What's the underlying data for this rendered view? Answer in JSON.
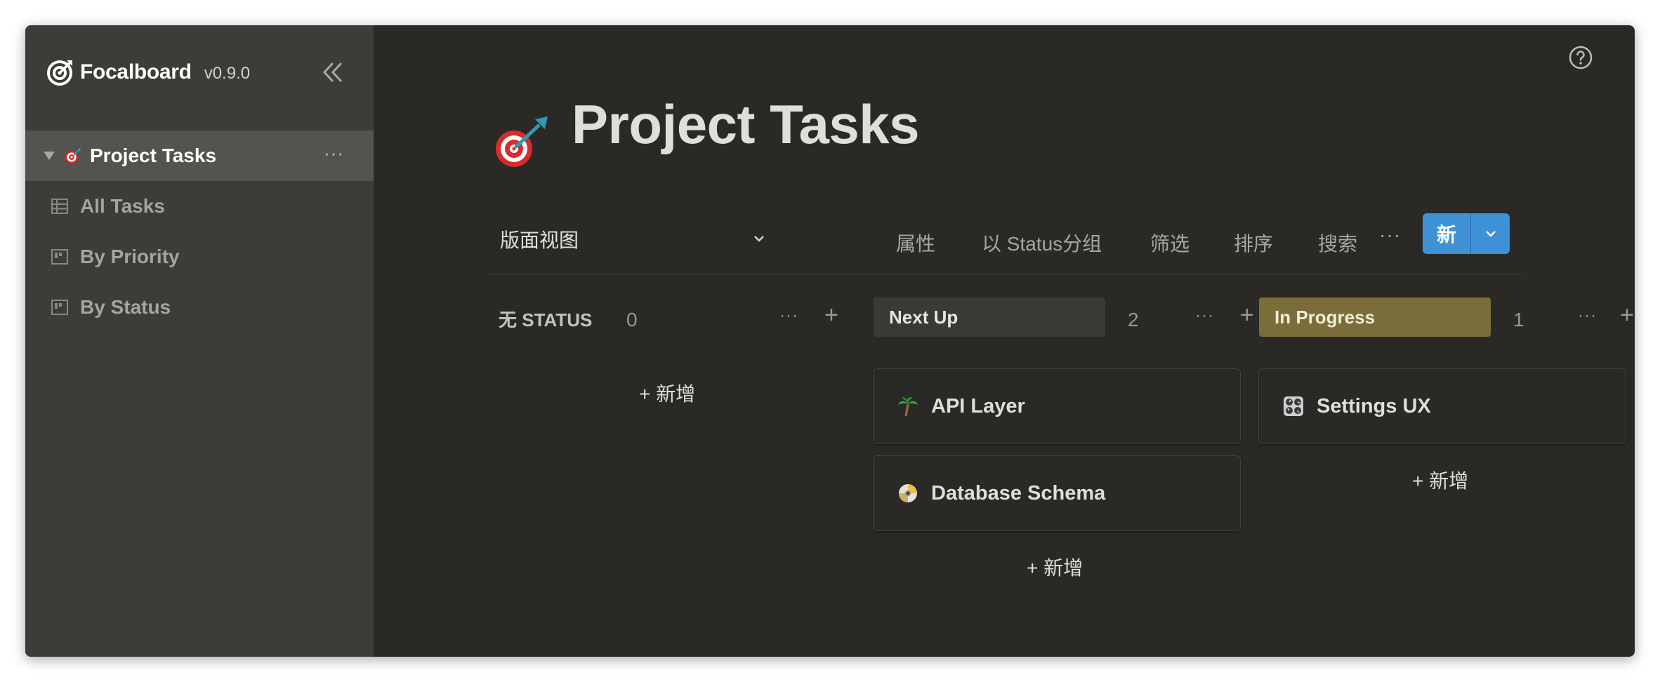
{
  "app": {
    "name": "Focalboard",
    "version": "v0.9.0"
  },
  "sidebar": {
    "board": {
      "label": "Project Tasks",
      "more": "···"
    },
    "views": [
      {
        "label": "All Tasks",
        "icon": "table-icon"
      },
      {
        "label": "By Priority",
        "icon": "board-icon"
      },
      {
        "label": "By Status",
        "icon": "board-icon"
      }
    ]
  },
  "page": {
    "title": "Project Tasks",
    "icon": "dart-target-icon"
  },
  "toolbar": {
    "view_name": "版面视图",
    "properties": "属性",
    "group_by": "以 Status分组",
    "filter": "筛选",
    "sort": "排序",
    "search": "搜索",
    "more": "···",
    "new": "新"
  },
  "columns": [
    {
      "title": "无 STATUS",
      "count": "0",
      "color": "",
      "add_label": "+ 新增",
      "cards": []
    },
    {
      "title": "Next Up",
      "count": "2",
      "color": "#3a3934",
      "add_label": "+ 新增",
      "cards": [
        {
          "title": "API Layer",
          "icon": "palm-tree-icon"
        },
        {
          "title": "Database Schema",
          "icon": "disc-icon"
        }
      ]
    },
    {
      "title": "In Progress",
      "count": "1",
      "color": "#7a6d3a",
      "add_label": "+ 新增",
      "cards": [
        {
          "title": "Settings UX",
          "icon": "control-knobs-icon"
        }
      ]
    }
  ],
  "column_controls": {
    "more": "···",
    "add": "+"
  },
  "colors": {
    "accent": "#3f92d6",
    "sidebar_bg": "#3e3c37",
    "main_bg": "#2b2925"
  }
}
